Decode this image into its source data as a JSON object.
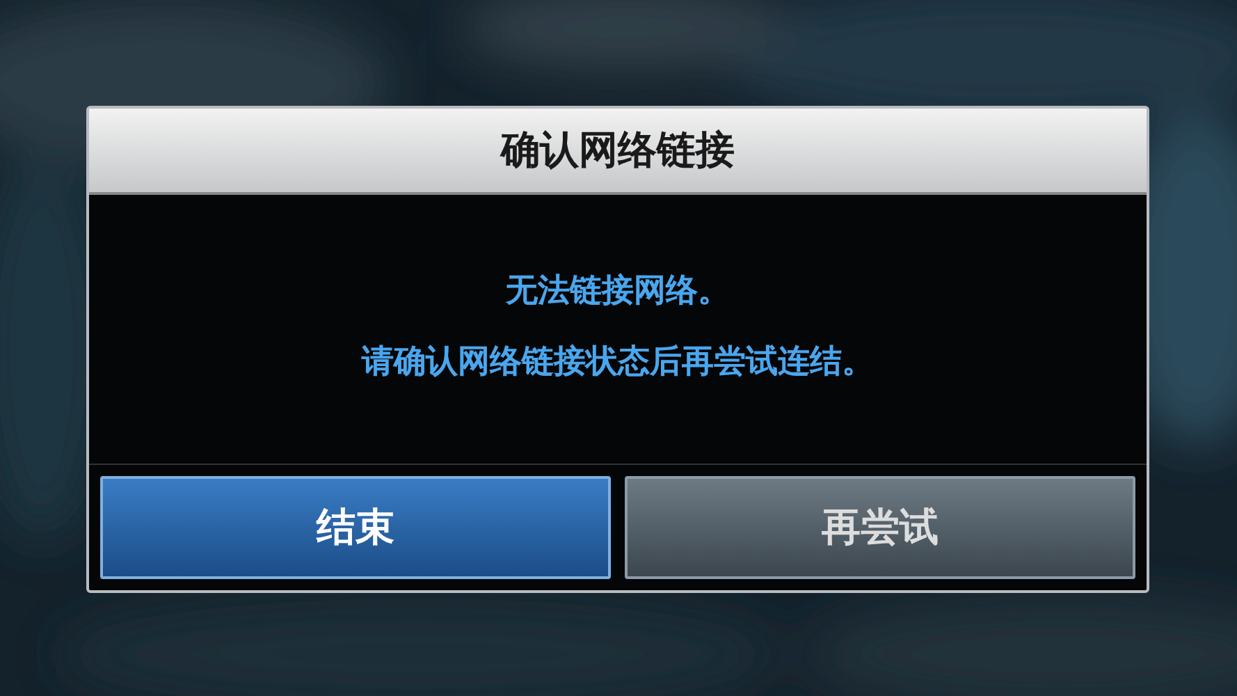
{
  "dialog": {
    "title": "确认网络链接",
    "messages": [
      "无法链接网络。",
      "请确认网络链接状态后再尝试连结。"
    ],
    "buttons": [
      {
        "label": "结束",
        "selected": true
      },
      {
        "label": "再尝试",
        "selected": false
      }
    ]
  }
}
